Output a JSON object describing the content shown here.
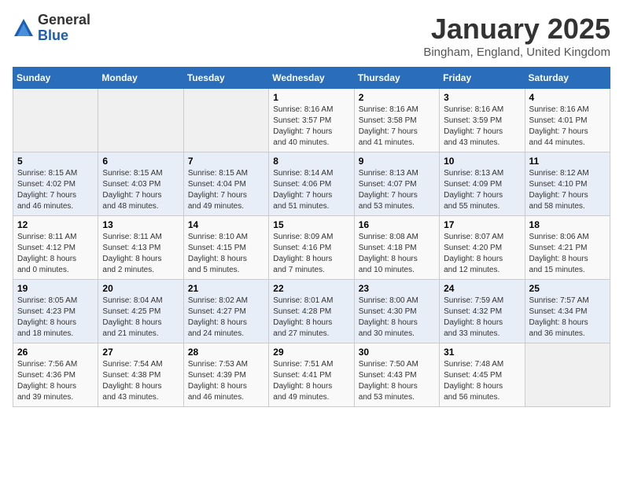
{
  "logo": {
    "general": "General",
    "blue": "Blue"
  },
  "title": "January 2025",
  "location": "Bingham, England, United Kingdom",
  "days_of_week": [
    "Sunday",
    "Monday",
    "Tuesday",
    "Wednesday",
    "Thursday",
    "Friday",
    "Saturday"
  ],
  "weeks": [
    [
      {
        "day": "",
        "info": ""
      },
      {
        "day": "",
        "info": ""
      },
      {
        "day": "",
        "info": ""
      },
      {
        "day": "1",
        "info": "Sunrise: 8:16 AM\nSunset: 3:57 PM\nDaylight: 7 hours\nand 40 minutes."
      },
      {
        "day": "2",
        "info": "Sunrise: 8:16 AM\nSunset: 3:58 PM\nDaylight: 7 hours\nand 41 minutes."
      },
      {
        "day": "3",
        "info": "Sunrise: 8:16 AM\nSunset: 3:59 PM\nDaylight: 7 hours\nand 43 minutes."
      },
      {
        "day": "4",
        "info": "Sunrise: 8:16 AM\nSunset: 4:01 PM\nDaylight: 7 hours\nand 44 minutes."
      }
    ],
    [
      {
        "day": "5",
        "info": "Sunrise: 8:15 AM\nSunset: 4:02 PM\nDaylight: 7 hours\nand 46 minutes."
      },
      {
        "day": "6",
        "info": "Sunrise: 8:15 AM\nSunset: 4:03 PM\nDaylight: 7 hours\nand 48 minutes."
      },
      {
        "day": "7",
        "info": "Sunrise: 8:15 AM\nSunset: 4:04 PM\nDaylight: 7 hours\nand 49 minutes."
      },
      {
        "day": "8",
        "info": "Sunrise: 8:14 AM\nSunset: 4:06 PM\nDaylight: 7 hours\nand 51 minutes."
      },
      {
        "day": "9",
        "info": "Sunrise: 8:13 AM\nSunset: 4:07 PM\nDaylight: 7 hours\nand 53 minutes."
      },
      {
        "day": "10",
        "info": "Sunrise: 8:13 AM\nSunset: 4:09 PM\nDaylight: 7 hours\nand 55 minutes."
      },
      {
        "day": "11",
        "info": "Sunrise: 8:12 AM\nSunset: 4:10 PM\nDaylight: 7 hours\nand 58 minutes."
      }
    ],
    [
      {
        "day": "12",
        "info": "Sunrise: 8:11 AM\nSunset: 4:12 PM\nDaylight: 8 hours\nand 0 minutes."
      },
      {
        "day": "13",
        "info": "Sunrise: 8:11 AM\nSunset: 4:13 PM\nDaylight: 8 hours\nand 2 minutes."
      },
      {
        "day": "14",
        "info": "Sunrise: 8:10 AM\nSunset: 4:15 PM\nDaylight: 8 hours\nand 5 minutes."
      },
      {
        "day": "15",
        "info": "Sunrise: 8:09 AM\nSunset: 4:16 PM\nDaylight: 8 hours\nand 7 minutes."
      },
      {
        "day": "16",
        "info": "Sunrise: 8:08 AM\nSunset: 4:18 PM\nDaylight: 8 hours\nand 10 minutes."
      },
      {
        "day": "17",
        "info": "Sunrise: 8:07 AM\nSunset: 4:20 PM\nDaylight: 8 hours\nand 12 minutes."
      },
      {
        "day": "18",
        "info": "Sunrise: 8:06 AM\nSunset: 4:21 PM\nDaylight: 8 hours\nand 15 minutes."
      }
    ],
    [
      {
        "day": "19",
        "info": "Sunrise: 8:05 AM\nSunset: 4:23 PM\nDaylight: 8 hours\nand 18 minutes."
      },
      {
        "day": "20",
        "info": "Sunrise: 8:04 AM\nSunset: 4:25 PM\nDaylight: 8 hours\nand 21 minutes."
      },
      {
        "day": "21",
        "info": "Sunrise: 8:02 AM\nSunset: 4:27 PM\nDaylight: 8 hours\nand 24 minutes."
      },
      {
        "day": "22",
        "info": "Sunrise: 8:01 AM\nSunset: 4:28 PM\nDaylight: 8 hours\nand 27 minutes."
      },
      {
        "day": "23",
        "info": "Sunrise: 8:00 AM\nSunset: 4:30 PM\nDaylight: 8 hours\nand 30 minutes."
      },
      {
        "day": "24",
        "info": "Sunrise: 7:59 AM\nSunset: 4:32 PM\nDaylight: 8 hours\nand 33 minutes."
      },
      {
        "day": "25",
        "info": "Sunrise: 7:57 AM\nSunset: 4:34 PM\nDaylight: 8 hours\nand 36 minutes."
      }
    ],
    [
      {
        "day": "26",
        "info": "Sunrise: 7:56 AM\nSunset: 4:36 PM\nDaylight: 8 hours\nand 39 minutes."
      },
      {
        "day": "27",
        "info": "Sunrise: 7:54 AM\nSunset: 4:38 PM\nDaylight: 8 hours\nand 43 minutes."
      },
      {
        "day": "28",
        "info": "Sunrise: 7:53 AM\nSunset: 4:39 PM\nDaylight: 8 hours\nand 46 minutes."
      },
      {
        "day": "29",
        "info": "Sunrise: 7:51 AM\nSunset: 4:41 PM\nDaylight: 8 hours\nand 49 minutes."
      },
      {
        "day": "30",
        "info": "Sunrise: 7:50 AM\nSunset: 4:43 PM\nDaylight: 8 hours\nand 53 minutes."
      },
      {
        "day": "31",
        "info": "Sunrise: 7:48 AM\nSunset: 4:45 PM\nDaylight: 8 hours\nand 56 minutes."
      },
      {
        "day": "",
        "info": ""
      }
    ]
  ]
}
